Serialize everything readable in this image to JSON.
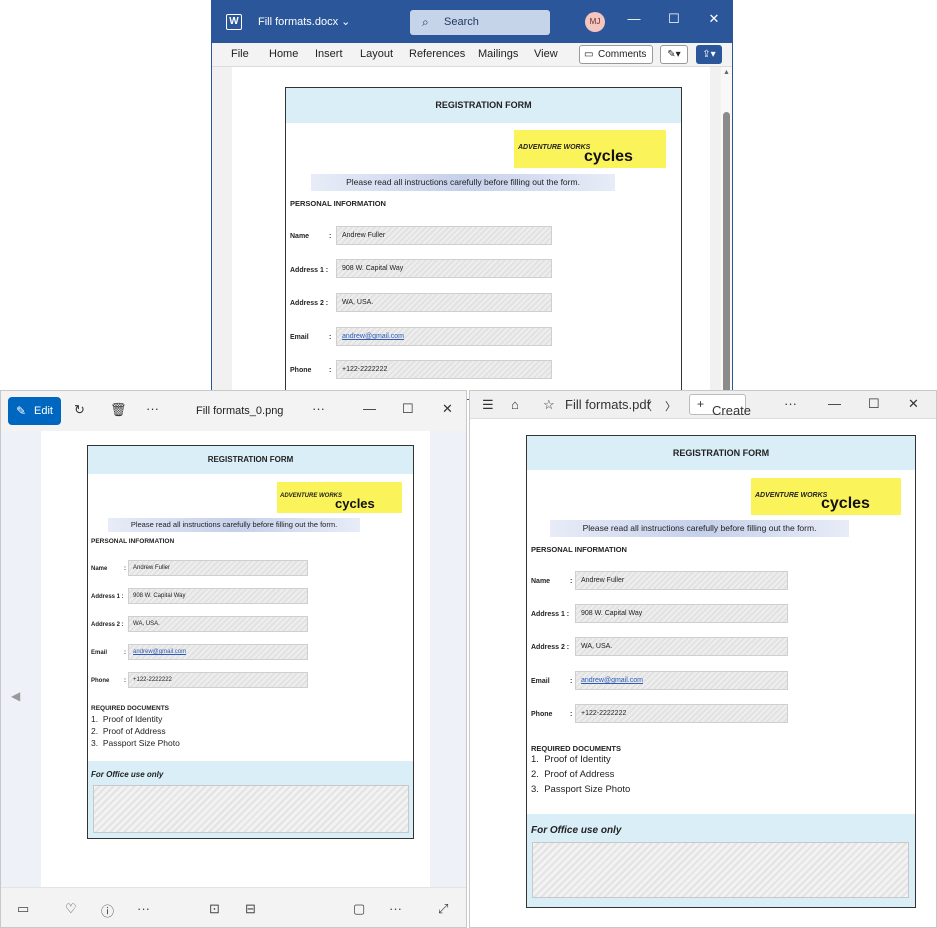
{
  "word": {
    "title": "Fill formats.docx",
    "title_chevron": "⌄",
    "search_placeholder": "Search",
    "avatar": "MJ",
    "ribbon_tabs": [
      "File",
      "Home",
      "Insert",
      "Layout",
      "References",
      "Mailings",
      "View"
    ],
    "comments_label": "Comments",
    "controls": {
      "minimize": "—",
      "maximize": "☐",
      "close": "✕"
    }
  },
  "photos": {
    "edit_label": "Edit",
    "file_name": "Fill formats_0.png",
    "more": "···",
    "controls": {
      "minimize": "—",
      "maximize": "☐",
      "close": "✕"
    }
  },
  "pdf": {
    "tab_title": "Fill formats.pdf",
    "create_label": "Create",
    "more": "···",
    "controls": {
      "minimize": "—",
      "maximize": "☐",
      "close": "✕"
    }
  },
  "form": {
    "header": "REGISTRATION FORM",
    "logo_line1": "ADVENTURE WORKS",
    "logo_line2": "cycles",
    "instructions": "Please read all instructions carefully before filling out the form.",
    "personal_info": "PERSONAL INFORMATION",
    "fields": [
      {
        "label": "Name",
        "colon": ":",
        "value": "Andrew Fuller"
      },
      {
        "label": "Address 1 :",
        "colon": "",
        "value": "908 W. Capital Way"
      },
      {
        "label": "Address 2 :",
        "colon": "",
        "value": "WA, USA."
      },
      {
        "label": "Email",
        "colon": ":",
        "value": "andrew@gmail.com"
      },
      {
        "label": "Phone",
        "colon": ":",
        "value": "+122-2222222"
      }
    ],
    "required_docs": "REQUIRED DOCUMENTS",
    "docs": [
      "Proof of Identity",
      "Proof of Address",
      "Passport Size Photo"
    ],
    "office_use": "For Office use only"
  }
}
